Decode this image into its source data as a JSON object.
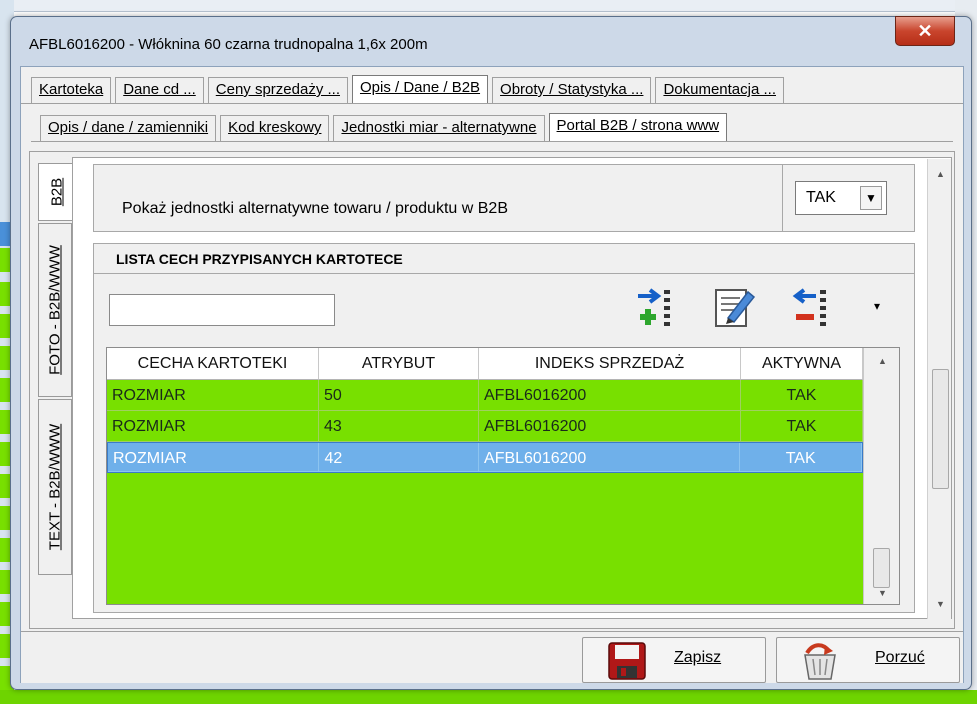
{
  "window": {
    "title": "AFBL6016200 - Włóknina 60 czarna trudnopalna 1,6x 200m",
    "close_glyph": "✕"
  },
  "tabs_main": [
    {
      "label": "Kartoteka",
      "active": false
    },
    {
      "label": "Dane cd ...",
      "active": false
    },
    {
      "label": "Ceny sprzedaży ...",
      "active": false
    },
    {
      "label": "Opis / Dane / B2B",
      "active": true
    },
    {
      "label": "Obroty / Statystyka ...",
      "active": false
    },
    {
      "label": "Dokumentacja ...",
      "active": false
    }
  ],
  "tabs_sub": [
    {
      "label": "Opis / dane / zamienniki",
      "active": false
    },
    {
      "label": "Kod kreskowy",
      "active": false
    },
    {
      "label": "Jednostki miar - alternatywne",
      "active": false
    },
    {
      "label": "Portal B2B / strona www",
      "active": true
    }
  ],
  "tabs_vertical": [
    {
      "label": "B2B",
      "active": true
    },
    {
      "label": "FOTO - B2B/WWW",
      "active": false
    },
    {
      "label": "TEXT - B2B/WWW",
      "active": false
    }
  ],
  "settings": {
    "show_alt_units_label": "Pokaż jednostki alternatywne towaru / produktu w B2B",
    "show_alt_units_value": "TAK"
  },
  "features": {
    "header": "LISTA CECH PRZYPISANYCH KARTOTECE",
    "search_value": "",
    "toolbar": {
      "add_icon": "add-row-icon",
      "edit_icon": "edit-document-icon",
      "remove_icon": "remove-row-icon",
      "more_glyph": "▾"
    },
    "columns": [
      "CECHA KARTOTEKI",
      "ATRYBUT",
      "INDEKS SPRZEDAŻ",
      "AKTYWNA"
    ],
    "rows": [
      {
        "cecha": "ROZMIAR",
        "atrybut": "50",
        "indeks": "AFBL6016200",
        "aktywna": "TAK",
        "selected": false
      },
      {
        "cecha": "ROZMIAR",
        "atrybut": "43",
        "indeks": "AFBL6016200",
        "aktywna": "TAK",
        "selected": false
      },
      {
        "cecha": "ROZMIAR",
        "atrybut": "42",
        "indeks": "AFBL6016200",
        "aktywna": "TAK",
        "selected": true
      }
    ],
    "row_color": "#78e000",
    "selected_color": "#6fb0ea"
  },
  "buttons": {
    "save": "Zapisz",
    "cancel": "Porzuć"
  }
}
